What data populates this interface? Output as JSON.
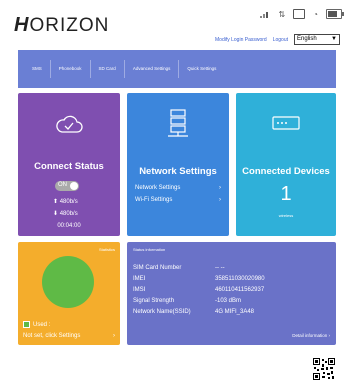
{
  "brand": {
    "logo_initial": "H",
    "logo_rest": "ORIZON"
  },
  "header": {
    "modify_link": "Modify Login Password",
    "logout": "Logout",
    "language": "English",
    "language_arrow": "▼"
  },
  "nav": {
    "tabs": [
      "SMS",
      "Phonebook",
      "SD Card",
      "Advanced Settings",
      "Quick Settings"
    ]
  },
  "connect": {
    "title": "Connect Status",
    "toggle": "ON",
    "up_rate": "480b/s",
    "down_rate": "480b/s",
    "duration": "00:04:00"
  },
  "network": {
    "title": "Network Settings",
    "items": [
      "Network Settings",
      "Wi-Fi Settings"
    ]
  },
  "devices": {
    "title": "Connected Devices",
    "count": "1",
    "sub": "wireless"
  },
  "stats": {
    "title": "Statistics",
    "used_label": "Used :",
    "not_set": "Not set, click Settings"
  },
  "status_info": {
    "title": "Status information",
    "rows": [
      {
        "k": "SIM Card Number",
        "v": "-- --"
      },
      {
        "k": "IMEI",
        "v": "358511030020980"
      },
      {
        "k": "IMSI",
        "v": "460110411562937"
      },
      {
        "k": "Signal Strength",
        "v": "-103 dBm"
      },
      {
        "k": "Network Name(SSID)",
        "v": "4G MIFI_3A48"
      }
    ],
    "detail_link": "Detail information"
  },
  "colors": {
    "nav": "#6a7fd4",
    "connect": "#7f4fb0",
    "network": "#3c86dc",
    "devices": "#2fb0d9",
    "stats": "#f4ad2c",
    "status": "#6a72c8"
  }
}
